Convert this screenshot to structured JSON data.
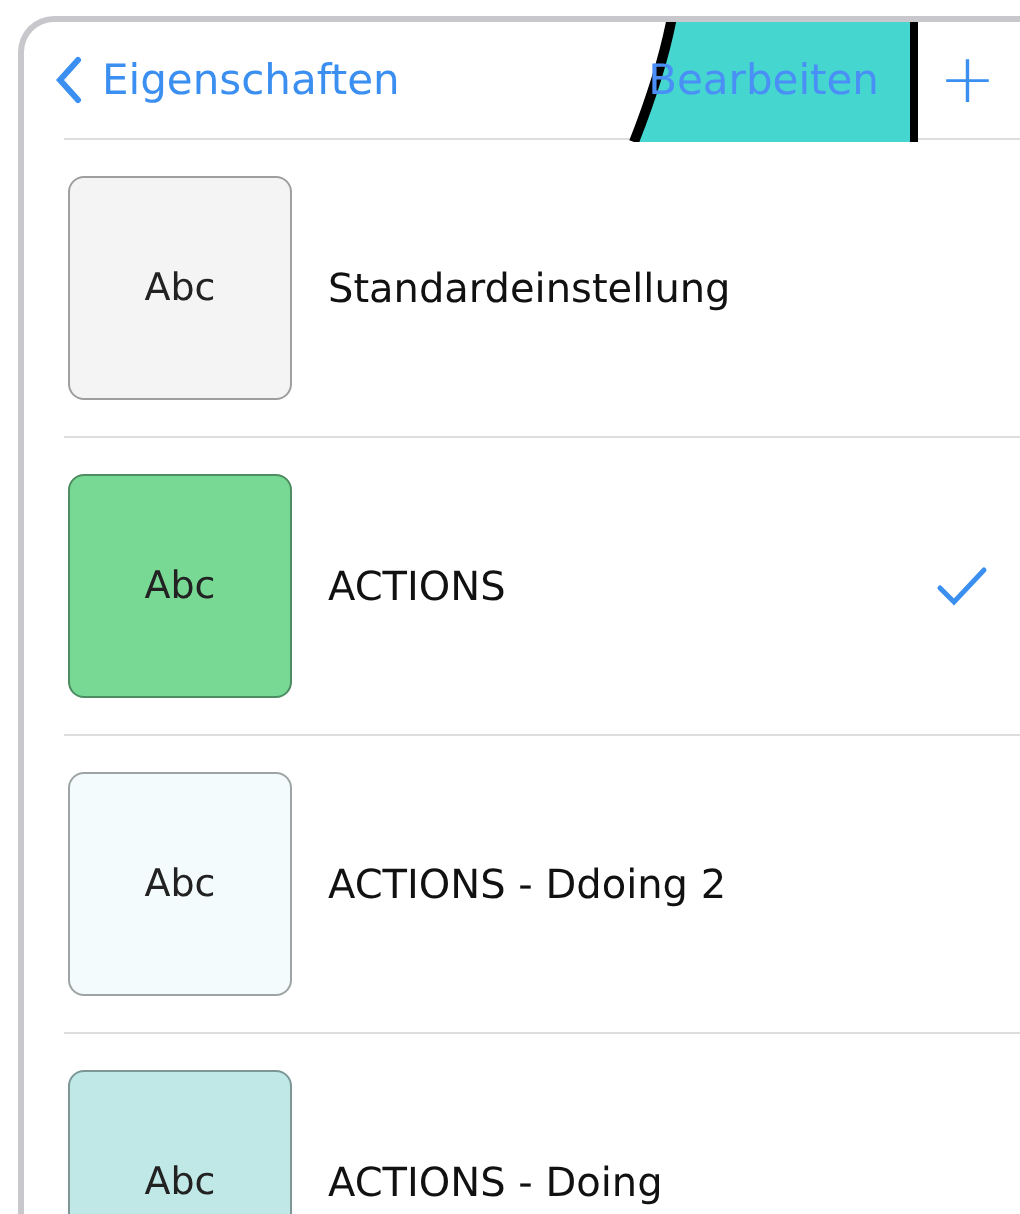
{
  "nav": {
    "back": "Eigenschaften",
    "edit": "Bearbeiten",
    "add": "+"
  },
  "styles": [
    {
      "preview": "Abc",
      "name": "Standardeinstellung",
      "selected": false,
      "color": "#f4f4f4"
    },
    {
      "preview": "Abc",
      "name": "ACTIONS",
      "selected": true,
      "color": "#78d995"
    },
    {
      "preview": "Abc",
      "name": "ACTIONS - Ddoing 2",
      "selected": false,
      "color": "#f3fbfc"
    },
    {
      "preview": "Abc",
      "name": "ACTIONS - Doing",
      "selected": false,
      "color": "#bfe8e6"
    }
  ]
}
